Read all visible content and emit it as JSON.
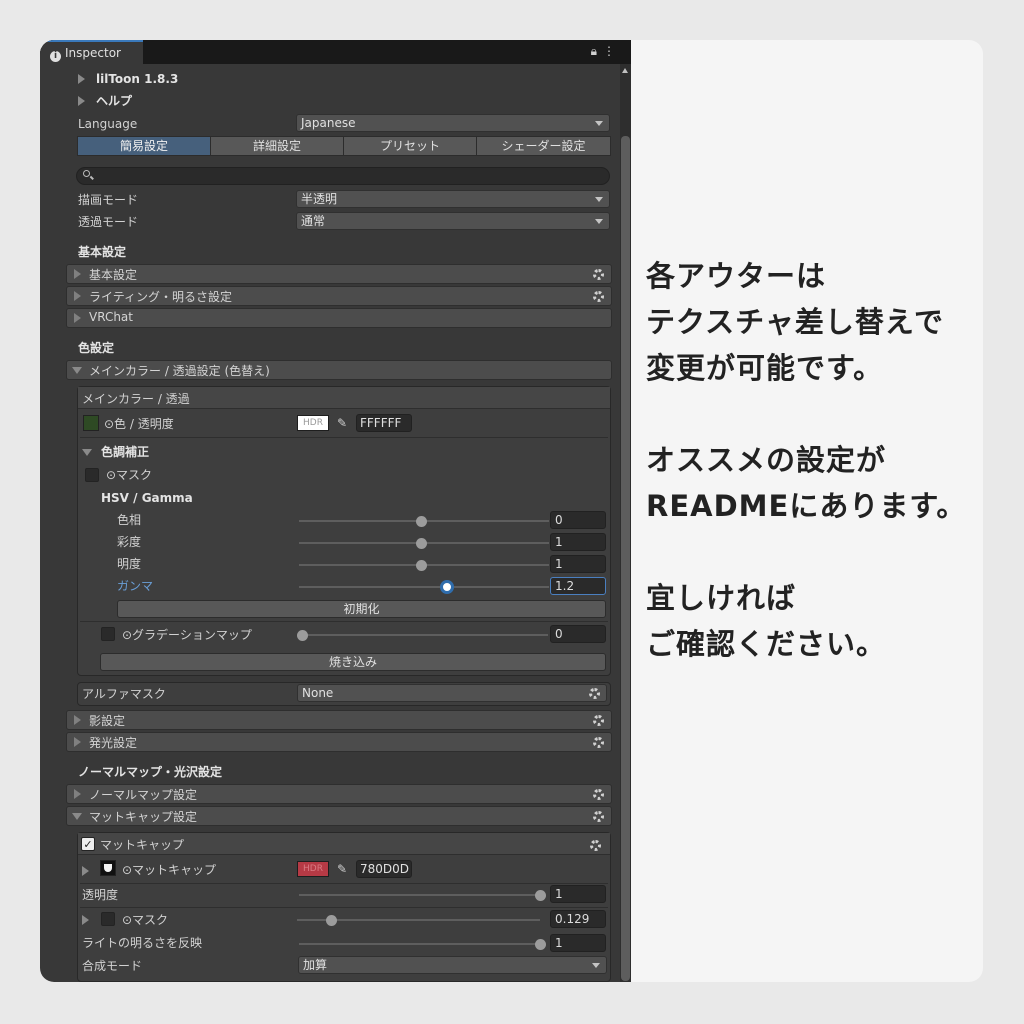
{
  "inspector": {
    "tab_title": "Inspector",
    "header": {
      "plugin": "lilToon 1.8.3",
      "help": "ヘルプ"
    },
    "language": {
      "label": "Language",
      "value": "Japanese"
    },
    "tabs": [
      "簡易設定",
      "詳細設定",
      "プリセット",
      "シェーダー設定"
    ],
    "render_mode": {
      "label": "描画モード",
      "value": "半透明"
    },
    "transparent_mode": {
      "label": "透過モード",
      "value": "通常"
    },
    "basic_section": {
      "title": "基本設定",
      "items": [
        "基本設定",
        "ライティング・明るさ設定",
        "VRChat"
      ]
    },
    "color_section": {
      "title": "色設定",
      "main_color_bar": "メインカラー / 透過設定 (色替え)",
      "box_title": "メインカラー / 透過",
      "color_label": "⊙色 / 透明度",
      "hdr": "HDR",
      "color_hex": "FFFFFF",
      "tone_title": "色調補正",
      "mask_label": "⊙マスク",
      "hsv_title": "HSV / Gamma",
      "sliders": [
        {
          "label": "色相",
          "value": "0",
          "fraction": 0.49
        },
        {
          "label": "彩度",
          "value": "1",
          "fraction": 0.49
        },
        {
          "label": "明度",
          "value": "1",
          "fraction": 0.49
        },
        {
          "label": "ガンマ",
          "value": "1.2",
          "fraction": 0.59
        }
      ],
      "reset_button": "初期化",
      "gradation": {
        "label": "⊙グラデーションマップ",
        "value": "0",
        "fraction": 0.0
      },
      "bake_button": "焼き込み",
      "alpha_mask": {
        "label": "アルファマスク",
        "value": "None"
      }
    },
    "shadow_item": "影設定",
    "emission_item": "発光設定",
    "normal_section": {
      "title": "ノーマルマップ・光沢設定",
      "normal_item": "ノーマルマップ設定",
      "matcap_bar": "マットキャップ設定",
      "matcap_box_title": "マットキャップ",
      "matcap_label": "⊙マットキャップ",
      "matcap_hex": "780D0D",
      "opacity": {
        "label": "透明度",
        "value": "1",
        "fraction": 1.0
      },
      "mask": {
        "label": "⊙マスク",
        "value": "0.129",
        "fraction": 0.14
      },
      "light": {
        "label": "ライトの明るさを反映",
        "value": "1",
        "fraction": 1.0
      },
      "blend": {
        "label": "合成モード",
        "value": "加算"
      }
    }
  },
  "note": {
    "lines": [
      "各アウターは",
      "テクスチャ差し替えで",
      "変更が可能です。",
      "",
      "オススメの設定が",
      "READMEにあります。",
      "",
      "宜しければ",
      "ご確認ください。"
    ]
  },
  "colors": {
    "accent": "#3a79bb",
    "panel_bg": "#383838",
    "matcap_color": "#b63a45"
  }
}
